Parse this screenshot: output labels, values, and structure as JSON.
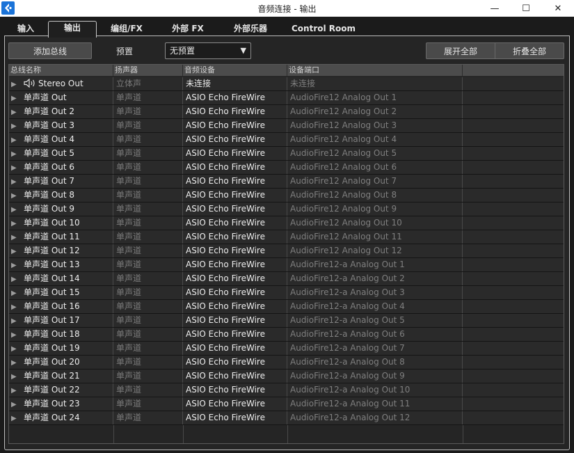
{
  "window": {
    "title": "音频连接 - 输出",
    "minimize_glyph": "—",
    "maximize_glyph": "☐",
    "close_glyph": "✕"
  },
  "tabs": [
    {
      "label": "输入",
      "active": false
    },
    {
      "label": "输出",
      "active": true
    },
    {
      "label": "编组/FX",
      "active": false
    },
    {
      "label": "外部 FX",
      "active": false
    },
    {
      "label": "外部乐器",
      "active": false
    },
    {
      "label": "Control Room",
      "active": false
    }
  ],
  "toolbar": {
    "add_bus_label": "添加总线",
    "preset_label": "预置",
    "preset_value": "无预置",
    "expand_all_label": "展开全部",
    "collapse_all_label": "折叠全部"
  },
  "table": {
    "columns": [
      "总线名称",
      "扬声器",
      "音频设备",
      "设备端口"
    ],
    "rows": [
      {
        "name": "Stereo Out",
        "speaker": "立体声",
        "device": "未连接",
        "port": "未连接",
        "icon": "speaker-icon"
      },
      {
        "name": "单声道 Out",
        "speaker": "单声道",
        "device": "ASIO Echo FireWire",
        "port": "AudioFire12 Analog Out 1"
      },
      {
        "name": "单声道 Out 2",
        "speaker": "单声道",
        "device": "ASIO Echo FireWire",
        "port": "AudioFire12 Analog Out 2"
      },
      {
        "name": "单声道 Out 3",
        "speaker": "单声道",
        "device": "ASIO Echo FireWire",
        "port": "AudioFire12 Analog Out 3"
      },
      {
        "name": "单声道 Out 4",
        "speaker": "单声道",
        "device": "ASIO Echo FireWire",
        "port": "AudioFire12 Analog Out 4"
      },
      {
        "name": "单声道 Out 5",
        "speaker": "单声道",
        "device": "ASIO Echo FireWire",
        "port": "AudioFire12 Analog Out 5"
      },
      {
        "name": "单声道 Out 6",
        "speaker": "单声道",
        "device": "ASIO Echo FireWire",
        "port": "AudioFire12 Analog Out 6"
      },
      {
        "name": "单声道 Out 7",
        "speaker": "单声道",
        "device": "ASIO Echo FireWire",
        "port": "AudioFire12 Analog Out 7"
      },
      {
        "name": "单声道 Out 8",
        "speaker": "单声道",
        "device": "ASIO Echo FireWire",
        "port": "AudioFire12 Analog Out 8"
      },
      {
        "name": "单声道 Out 9",
        "speaker": "单声道",
        "device": "ASIO Echo FireWire",
        "port": "AudioFire12 Analog Out 9"
      },
      {
        "name": "单声道 Out 10",
        "speaker": "单声道",
        "device": "ASIO Echo FireWire",
        "port": "AudioFire12 Analog Out 10"
      },
      {
        "name": "单声道 Out 11",
        "speaker": "单声道",
        "device": "ASIO Echo FireWire",
        "port": "AudioFire12 Analog Out 11"
      },
      {
        "name": "单声道 Out 12",
        "speaker": "单声道",
        "device": "ASIO Echo FireWire",
        "port": "AudioFire12 Analog Out 12"
      },
      {
        "name": "单声道 Out 13",
        "speaker": "单声道",
        "device": "ASIO Echo FireWire",
        "port": "AudioFire12-a Analog Out 1"
      },
      {
        "name": "单声道 Out 14",
        "speaker": "单声道",
        "device": "ASIO Echo FireWire",
        "port": "AudioFire12-a Analog Out 2"
      },
      {
        "name": "单声道 Out 15",
        "speaker": "单声道",
        "device": "ASIO Echo FireWire",
        "port": "AudioFire12-a Analog Out 3"
      },
      {
        "name": "单声道 Out 16",
        "speaker": "单声道",
        "device": "ASIO Echo FireWire",
        "port": "AudioFire12-a Analog Out 4"
      },
      {
        "name": "单声道 Out 17",
        "speaker": "单声道",
        "device": "ASIO Echo FireWire",
        "port": "AudioFire12-a Analog Out 5"
      },
      {
        "name": "单声道 Out 18",
        "speaker": "单声道",
        "device": "ASIO Echo FireWire",
        "port": "AudioFire12-a Analog Out 6"
      },
      {
        "name": "单声道 Out 19",
        "speaker": "单声道",
        "device": "ASIO Echo FireWire",
        "port": "AudioFire12-a Analog Out 7"
      },
      {
        "name": "单声道 Out 20",
        "speaker": "单声道",
        "device": "ASIO Echo FireWire",
        "port": "AudioFire12-a Analog Out 8"
      },
      {
        "name": "单声道 Out 21",
        "speaker": "单声道",
        "device": "ASIO Echo FireWire",
        "port": "AudioFire12-a Analog Out 9"
      },
      {
        "name": "单声道 Out 22",
        "speaker": "单声道",
        "device": "ASIO Echo FireWire",
        "port": "AudioFire12-a Analog Out 10"
      },
      {
        "name": "单声道 Out 23",
        "speaker": "单声道",
        "device": "ASIO Echo FireWire",
        "port": "AudioFire12-a Analog Out 11"
      },
      {
        "name": "单声道 Out 24",
        "speaker": "单声道",
        "device": "ASIO Echo FireWire",
        "port": "AudioFire12-a Analog Out 12"
      }
    ]
  },
  "colors": {
    "background": "#1b1b1b",
    "panel": "#252525",
    "row": "#2a2a2a",
    "header": "#4c4c4c",
    "app_icon": "#1a73d8"
  }
}
